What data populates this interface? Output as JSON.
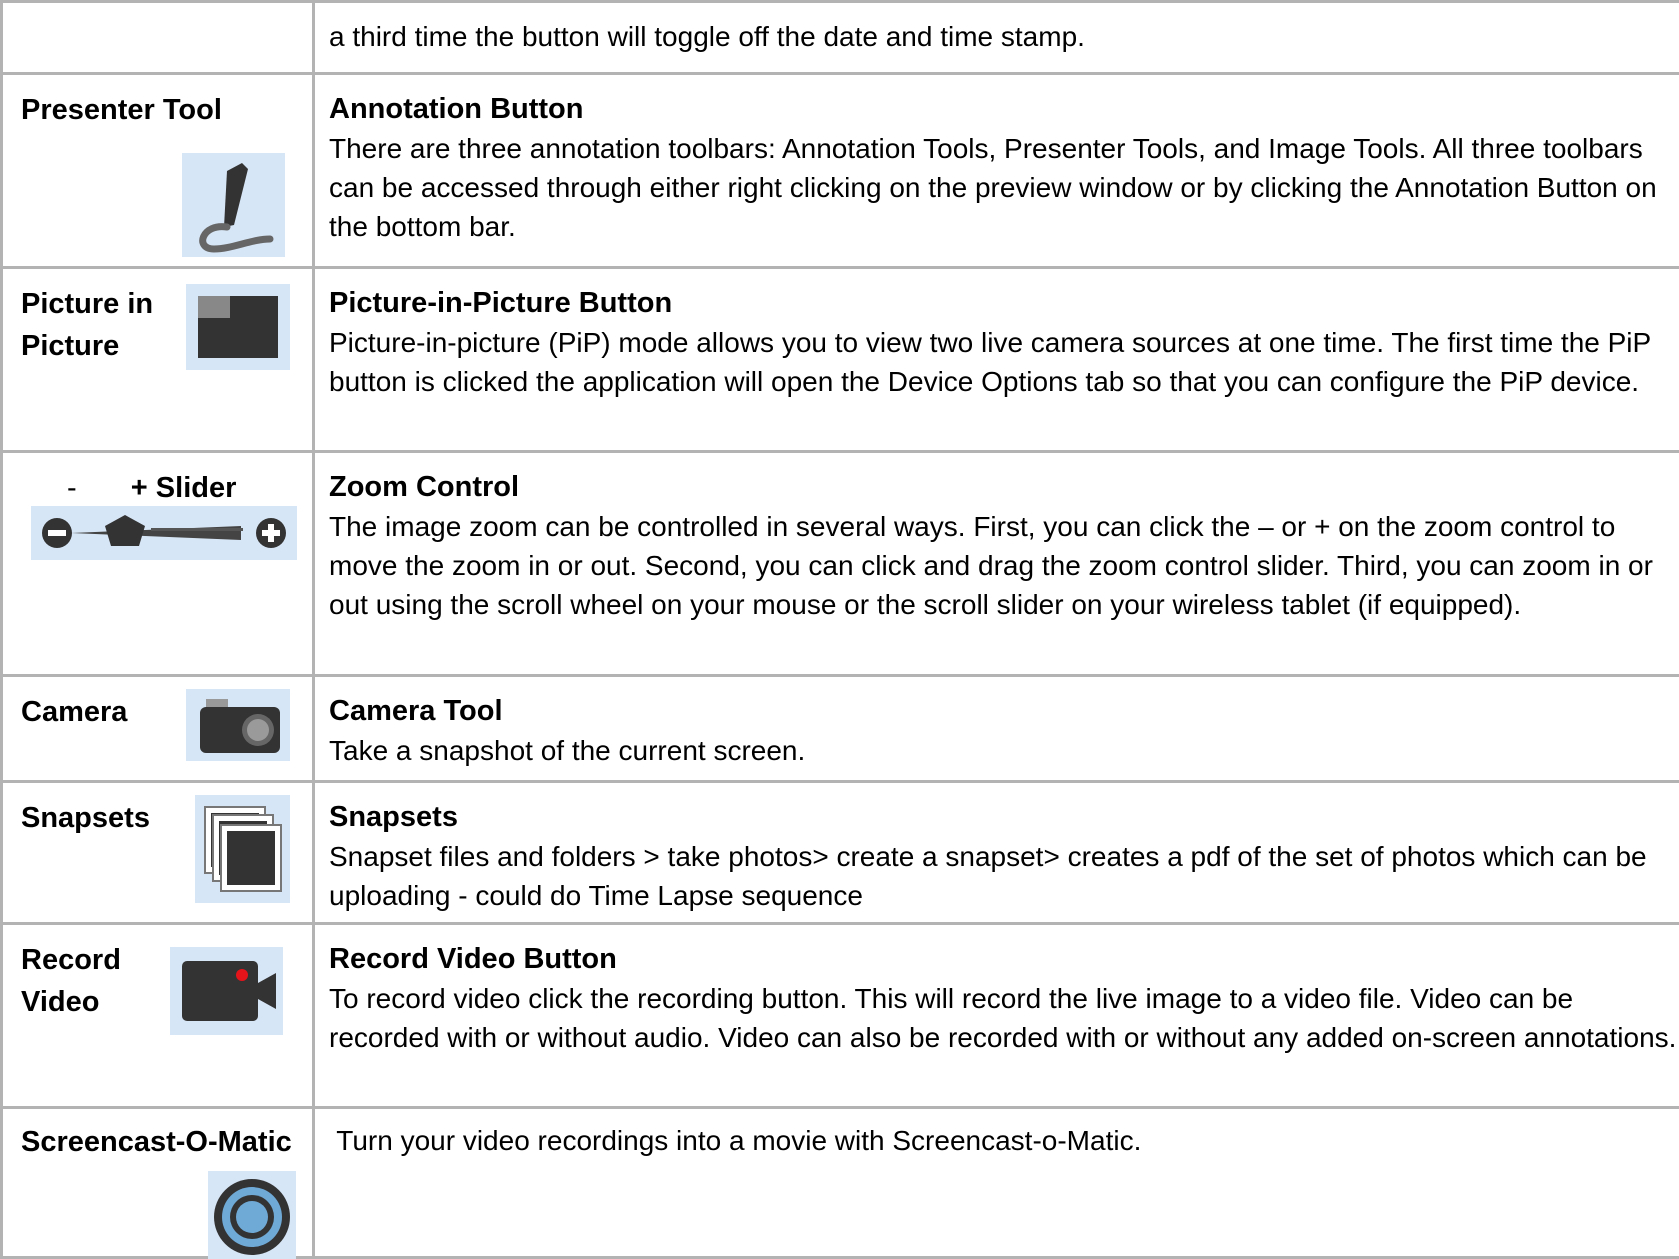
{
  "rows": [
    {
      "left_label": "",
      "title": "",
      "text": "a third time the button will toggle off the date and time stamp."
    },
    {
      "left_label": "Presenter Tool",
      "icon": "pen-icon",
      "title": "Annotation Button",
      "text": "There are three annotation toolbars: Annotation Tools, Presenter Tools, and Image Tools.  All three toolbars can be accessed through either right clicking on the preview window or by clicking the Annotation Button on the bottom bar."
    },
    {
      "left_label_line1": "Picture in",
      "left_label_line2": "Picture",
      "icon": "picture-in-picture-icon",
      "title": "Picture-in-Picture Button",
      "text": "Picture-in-picture (PiP) mode allows you to view two live camera sources at one time. The first time the PiP button is clicked the application will open the Device Options tab so that you can configure the PiP device."
    },
    {
      "left_label_minus": "-",
      "left_label_plus": "+ Slider",
      "icon": "zoom-slider-icon",
      "title": "Zoom Control",
      "text": "The image zoom can be controlled in several ways.  First, you can click the – or + on the zoom control to move the zoom in or out.  Second, you can click and drag the zoom control slider.  Third, you can zoom in or out using the scroll wheel on your mouse or the scroll slider on your wireless tablet (if equipped)."
    },
    {
      "left_label": "Camera",
      "icon": "camera-icon",
      "title": "Camera Tool",
      "text": "Take a snapshot of the current screen."
    },
    {
      "left_label": "Snapsets",
      "icon": "snapsets-icon",
      "title": "Snapsets",
      "text": "Snapset files and folders > take photos> create a snapset> creates a pdf of the set of photos which can be uploading  - could do Time Lapse sequence"
    },
    {
      "left_label_line1": "Record",
      "left_label_line2": "Video",
      "icon": "record-video-icon",
      "title": "Record Video Button",
      "text": "To record video click the recording button. This will record the live image to a video file. Video can be recorded with or without audio. Video can also be recorded with or without any added on-screen annotations."
    },
    {
      "left_label": "Screencast-O-Matic",
      "icon": "screencast-icon",
      "title": "",
      "text": " Turn your video recordings into a movie with Screencast-o-Matic."
    }
  ],
  "colors": {
    "border": "#b3b3b3",
    "icon_bg": "#d7e6f6",
    "icon_dark": "#3a3a3a",
    "record_dot": "#e5141b",
    "screencast_blue": "#6fa9d6"
  }
}
